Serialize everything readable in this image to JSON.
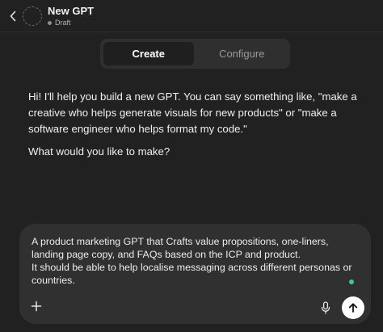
{
  "header": {
    "back_icon": "chevron-left-icon",
    "avatar_icon": "dashed-circle-avatar",
    "title": "New GPT",
    "status": "Draft",
    "status_dot_color": "#8e8e8e"
  },
  "tabs": [
    {
      "label": "Create",
      "active": true
    },
    {
      "label": "Configure",
      "active": false
    }
  ],
  "message": {
    "paragraphs": [
      "Hi! I'll help you build a new GPT. You can say something like, \"make a creative who helps generate visuals for new products\" or \"make a software engineer who helps format my code.\"",
      "What would you like to make?"
    ]
  },
  "composer": {
    "text": "A product marketing GPT that Crafts value propositions, one-liners, landing page copy, and FAQs based on the ICP and product.\nIt should be able to help localise messaging across different personas or countries.",
    "plus_icon": "plus-icon",
    "mic_icon": "microphone-icon",
    "send_icon": "arrow-up-icon",
    "indicator_color": "#3cc7a1"
  },
  "colors": {
    "background": "#212121",
    "tabs_bg": "#2f2f2f",
    "active_tab_bg": "#1f1f1f",
    "composer_bg": "#303030",
    "send_bg": "#ffffff"
  }
}
